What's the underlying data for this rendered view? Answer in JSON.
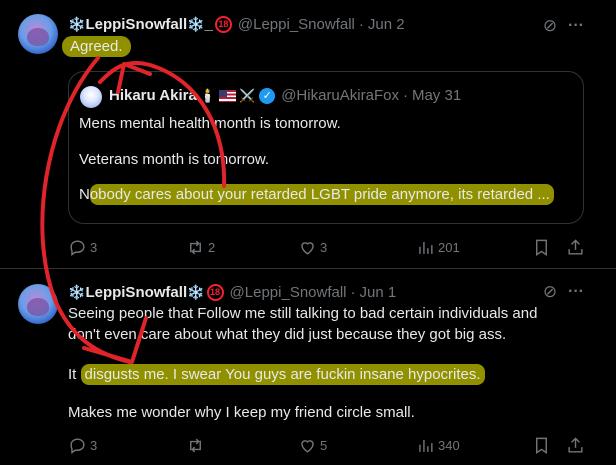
{
  "tweets": [
    {
      "display_name": "LeppiSnowfall",
      "name_suffix": "_",
      "badge": "18",
      "handle": "@Leppi_Snowfall",
      "date": "Jun 2",
      "text": "Agreed.",
      "quote": {
        "display_name": "Hikaru Akira",
        "emojis": "🕯️",
        "handle": "@HikaruAkiraFox",
        "date": "May 31",
        "line1": "Mens mental health month is tomorrow.",
        "line2": "Veterans month is tomorrow.",
        "line3_start": "N",
        "line3_highlight": "obody cares about your retarded LGBT pride anymore, its retarded ..."
      },
      "stats": {
        "replies": "3",
        "retweets": "2",
        "likes": "3",
        "views": "201"
      }
    },
    {
      "display_name": "LeppiSnowfall",
      "name_suffix": "",
      "badge": "18",
      "handle": "@Leppi_Snowfall",
      "date": "Jun 1",
      "line1": "Seeing people that Follow me still talking to bad certain individuals and",
      "line2": "don't even care about what they did just because they got big ass.",
      "line3_start": "It",
      "line3_highlight": "disgusts me. I swear You guys are fuckin insane hypocrites.",
      "line4": "Makes me wonder why I keep my friend circle small.",
      "stats": {
        "replies": "3",
        "retweets": "",
        "likes": "5",
        "views": "340"
      }
    }
  ],
  "colors": {
    "background": "#000000",
    "text": "#e7e9ea",
    "muted": "#71767b",
    "verified": "#1d9bf0",
    "highlight": "#aaaa00",
    "annotation_arrow": "#e0242a"
  },
  "icons": [
    "snowflake-icon",
    "grok-icon",
    "more-icon",
    "verified-icon",
    "reply-icon",
    "retweet-icon",
    "like-icon",
    "views-icon",
    "bookmark-icon",
    "share-icon"
  ]
}
